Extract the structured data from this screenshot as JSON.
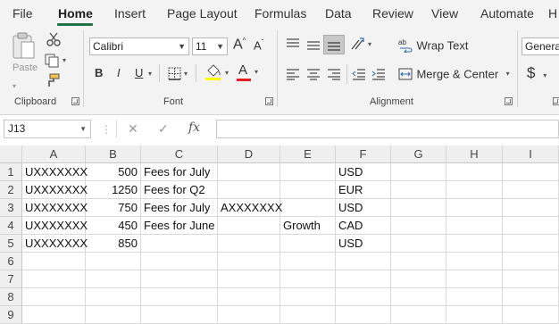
{
  "menu": {
    "tabs": [
      "File",
      "Home",
      "Insert",
      "Page Layout",
      "Formulas",
      "Data",
      "Review",
      "View",
      "Automate",
      "H"
    ],
    "active": "Home"
  },
  "ribbon": {
    "clipboard": {
      "paste_label": "Paste",
      "group_label": "Clipboard"
    },
    "font": {
      "font_name": "Calibri",
      "font_size": "11",
      "bold": "B",
      "italic": "I",
      "underline": "U",
      "group_label": "Font",
      "increase_glyph": "A",
      "decrease_glyph": "A",
      "font_color_glyph": "A"
    },
    "alignment": {
      "wrap_text": "Wrap Text",
      "merge_center": "Merge & Center",
      "group_label": "Alignment"
    },
    "number": {
      "format": "General",
      "currency_symbol": "$"
    }
  },
  "formula_bar": {
    "name_box": "J13",
    "fx_label": "fx",
    "cancel_glyph": "✕",
    "enter_glyph": "✓",
    "value": ""
  },
  "sheet": {
    "columns": [
      "A",
      "B",
      "C",
      "D",
      "E",
      "F",
      "G",
      "H",
      "I"
    ],
    "rows": [
      "1",
      "2",
      "3",
      "4",
      "5",
      "6",
      "7",
      "8",
      "9"
    ],
    "cells": [
      {
        "row": 0,
        "col": 0,
        "text": "UXXXXXXX",
        "align": "left"
      },
      {
        "row": 0,
        "col": 1,
        "text": "500",
        "align": "right"
      },
      {
        "row": 0,
        "col": 2,
        "text": "Fees for July",
        "align": "left"
      },
      {
        "row": 0,
        "col": 5,
        "text": "USD",
        "align": "left"
      },
      {
        "row": 1,
        "col": 0,
        "text": "UXXXXXXX",
        "align": "left"
      },
      {
        "row": 1,
        "col": 1,
        "text": "1250",
        "align": "right"
      },
      {
        "row": 1,
        "col": 2,
        "text": "Fees for Q2",
        "align": "left"
      },
      {
        "row": 1,
        "col": 5,
        "text": "EUR",
        "align": "left"
      },
      {
        "row": 2,
        "col": 0,
        "text": "UXXXXXXX",
        "align": "left"
      },
      {
        "row": 2,
        "col": 1,
        "text": "750",
        "align": "right"
      },
      {
        "row": 2,
        "col": 2,
        "text": "Fees for July",
        "align": "left"
      },
      {
        "row": 2,
        "col": 3,
        "text": "AXXXXXXX",
        "align": "left"
      },
      {
        "row": 2,
        "col": 5,
        "text": "USD",
        "align": "left"
      },
      {
        "row": 3,
        "col": 0,
        "text": "UXXXXXXX",
        "align": "left"
      },
      {
        "row": 3,
        "col": 1,
        "text": "450",
        "align": "right"
      },
      {
        "row": 3,
        "col": 2,
        "text": "Fees for June",
        "align": "left"
      },
      {
        "row": 3,
        "col": 4,
        "text": "Growth",
        "align": "left"
      },
      {
        "row": 3,
        "col": 5,
        "text": "CAD",
        "align": "left"
      },
      {
        "row": 4,
        "col": 0,
        "text": "UXXXXXXX",
        "align": "left"
      },
      {
        "row": 4,
        "col": 1,
        "text": "850",
        "align": "right"
      },
      {
        "row": 4,
        "col": 5,
        "text": "USD",
        "align": "left"
      }
    ]
  },
  "colors": {
    "accent": "#217346",
    "highlight_yellow": "#ffff00",
    "font_red": "#e02020"
  },
  "icons": [
    "paste-icon",
    "cut-icon",
    "copy-icon",
    "format-painter-icon",
    "increase-font-icon",
    "decrease-font-icon",
    "borders-icon",
    "fill-color-icon",
    "font-color-icon",
    "align-top-icon",
    "align-middle-icon",
    "align-bottom-icon",
    "orientation-icon",
    "wrap-text-icon",
    "align-left-icon",
    "align-center-icon",
    "align-right-icon",
    "decrease-indent-icon",
    "increase-indent-icon",
    "merge-center-icon",
    "currency-icon"
  ]
}
